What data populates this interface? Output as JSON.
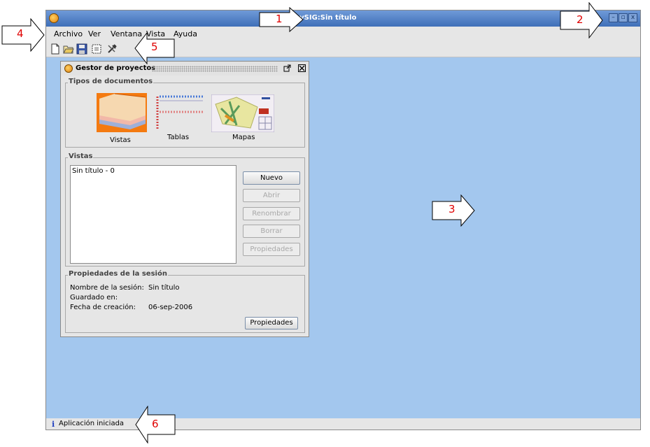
{
  "window": {
    "title": "gvSIG:Sin título",
    "minimize": "–",
    "maximize": "▫",
    "close": "x"
  },
  "menu": [
    "Archivo",
    "Ver",
    "Ventana",
    "Vista",
    "Ayuda"
  ],
  "frame": {
    "title": "Gestor de proyectos",
    "doc_types": {
      "title": "Tipos de documentos",
      "items": [
        "Vistas",
        "Tablas",
        "Mapas"
      ]
    },
    "views": {
      "title": "Vistas",
      "list": [
        "Sin título - 0"
      ],
      "buttons": {
        "new": "Nuevo",
        "open": "Abrir",
        "rename": "Renombrar",
        "delete": "Borrar",
        "properties": "Propiedades"
      }
    },
    "session": {
      "title": "Propiedades de la sesión",
      "name_label": "Nombre de la sesión:",
      "name_value": "Sin título",
      "saved_label": "Guardado en:",
      "saved_value": "",
      "date_label": "Fecha de creación:",
      "date_value": "06-sep-2006",
      "properties_button": "Propiedades"
    }
  },
  "status": {
    "icon": "info-icon",
    "text": "Aplicación iniciada"
  },
  "callouts": [
    "1",
    "2",
    "3",
    "4",
    "5",
    "6"
  ],
  "colors": {
    "titlebar": "#3f6fb8",
    "desktop": "#a3c7ee",
    "callout_number": "#e00000"
  }
}
